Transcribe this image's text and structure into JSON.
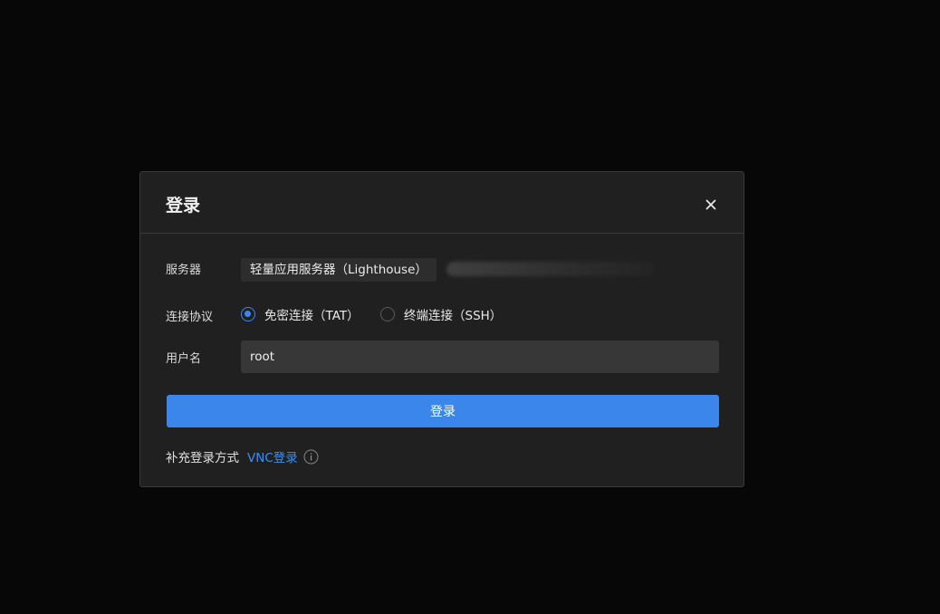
{
  "dialog": {
    "title": "登录",
    "close_icon": "close-icon"
  },
  "server": {
    "label": "服务器",
    "tag": "轻量应用服务器（Lighthouse）",
    "id_redacted": true
  },
  "protocol": {
    "label": "连接协议",
    "options": [
      {
        "label": "免密连接（TAT）",
        "selected": true
      },
      {
        "label": "终端连接（SSH）",
        "selected": false
      }
    ]
  },
  "username": {
    "label": "用户名",
    "value": "root"
  },
  "actions": {
    "login_label": "登录"
  },
  "extra": {
    "label": "补充登录方式",
    "vnc_link": "VNC登录",
    "info_icon": "info-icon"
  },
  "colors": {
    "accent": "#3a86ea",
    "link": "#3b8ff0",
    "background": "#070707",
    "dialog_bg": "#202020"
  }
}
